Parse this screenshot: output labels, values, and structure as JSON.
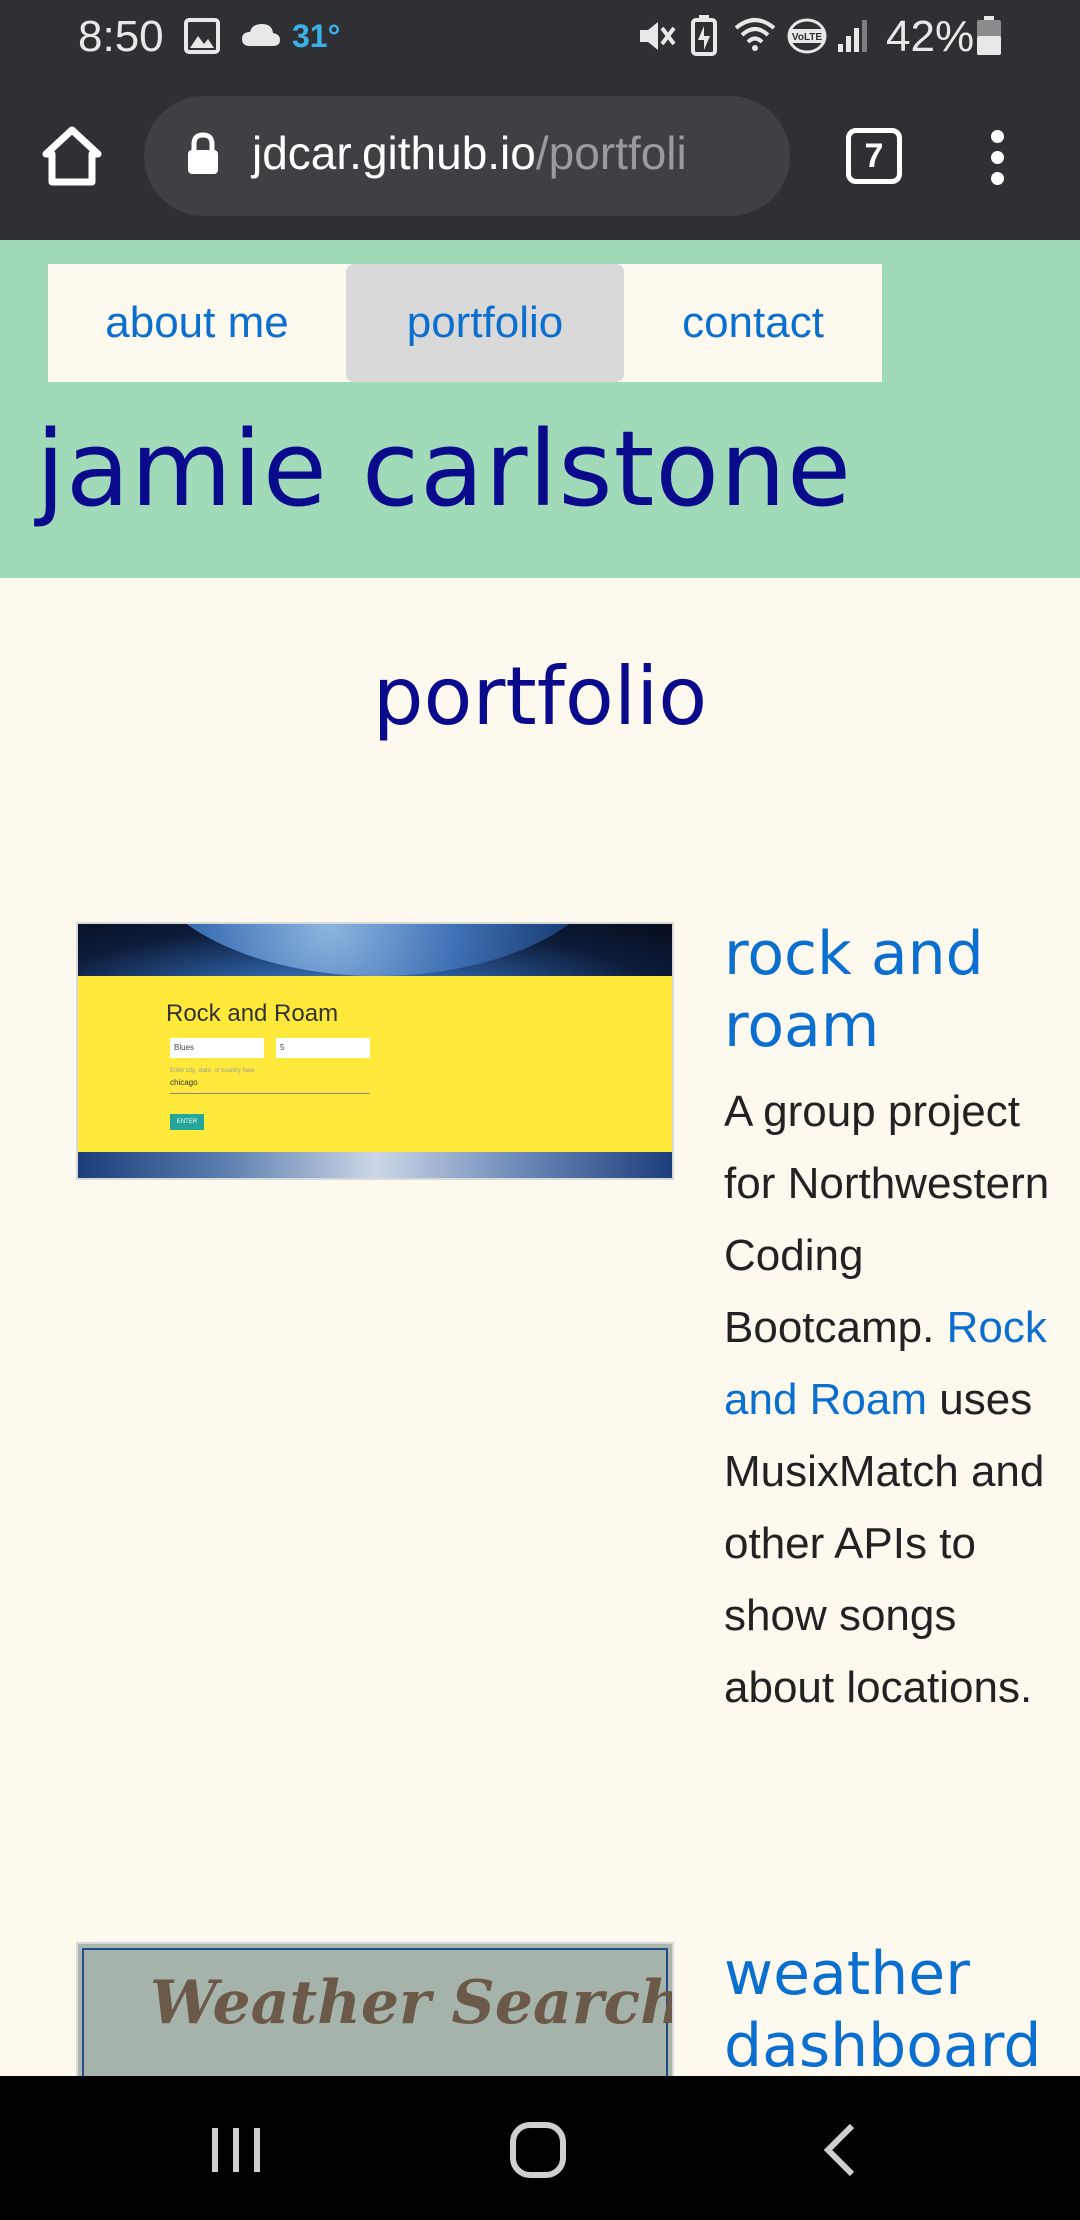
{
  "status_bar": {
    "time": "8:50",
    "temperature": "31°",
    "battery": "42%",
    "icons": [
      "image-icon",
      "cloud-icon",
      "mute-icon",
      "battery-saver-icon",
      "wifi-icon",
      "volte-icon",
      "signal-icon",
      "battery-icon"
    ]
  },
  "browser": {
    "url_host": "jdcar.github.io",
    "url_path": "/portfoli",
    "tab_count": "7"
  },
  "nav": {
    "about": "about me",
    "portfolio": "portfolio",
    "contact": "contact",
    "active": "portfolio"
  },
  "site_name": "jamie carlstone",
  "page_title": "portfolio",
  "projects": [
    {
      "title_line1": "rock and",
      "title_line2": "roam",
      "desc_before": "A group project for Northwestern Coding Bootcamp.",
      "link": "Rock and Roam",
      "desc_after": "uses MusixMatch and other APIs to show songs about locations.",
      "thumb": {
        "title": "Rock and Roam",
        "select1": "Blues",
        "select2": "5",
        "hint": "Enter city, state, or country here",
        "input": "chicago",
        "button": "ENTER"
      }
    },
    {
      "title_line1": "weather",
      "title_line2": "dashboard",
      "thumb": {
        "title": "Weather Search"
      }
    }
  ],
  "colors": {
    "header_bg": "#a0dab8",
    "page_bg": "#fdf9ef",
    "heading": "#0a0a8c",
    "link": "#0b6fd0"
  }
}
